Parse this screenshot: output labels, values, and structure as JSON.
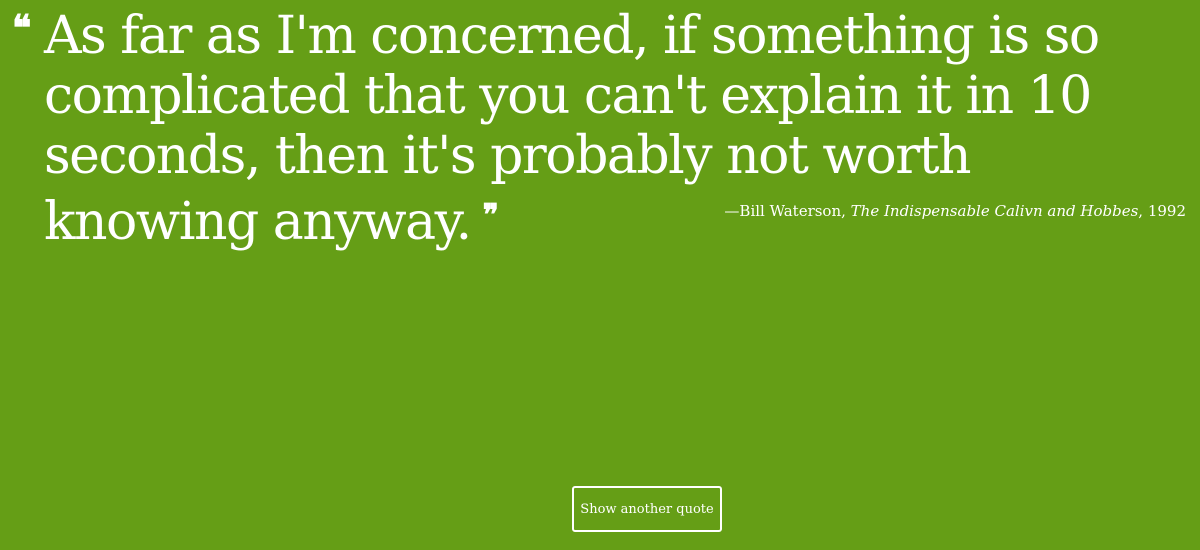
{
  "quote": {
    "open_mark": "❝",
    "text": "As far as I'm concerned, if something is so complicated that you can't explain it in 10 seconds, then it's probably not worth knowing anyway.",
    "close_mark": "❞"
  },
  "attribution": {
    "dash_author": "—Bill Waterson, ",
    "work": "The Indispensable Calivn and Hobbes",
    "year": ", 1992"
  },
  "button": {
    "label": "Show another quote"
  },
  "colors": {
    "background": "#659e16",
    "text": "#ffffff"
  }
}
